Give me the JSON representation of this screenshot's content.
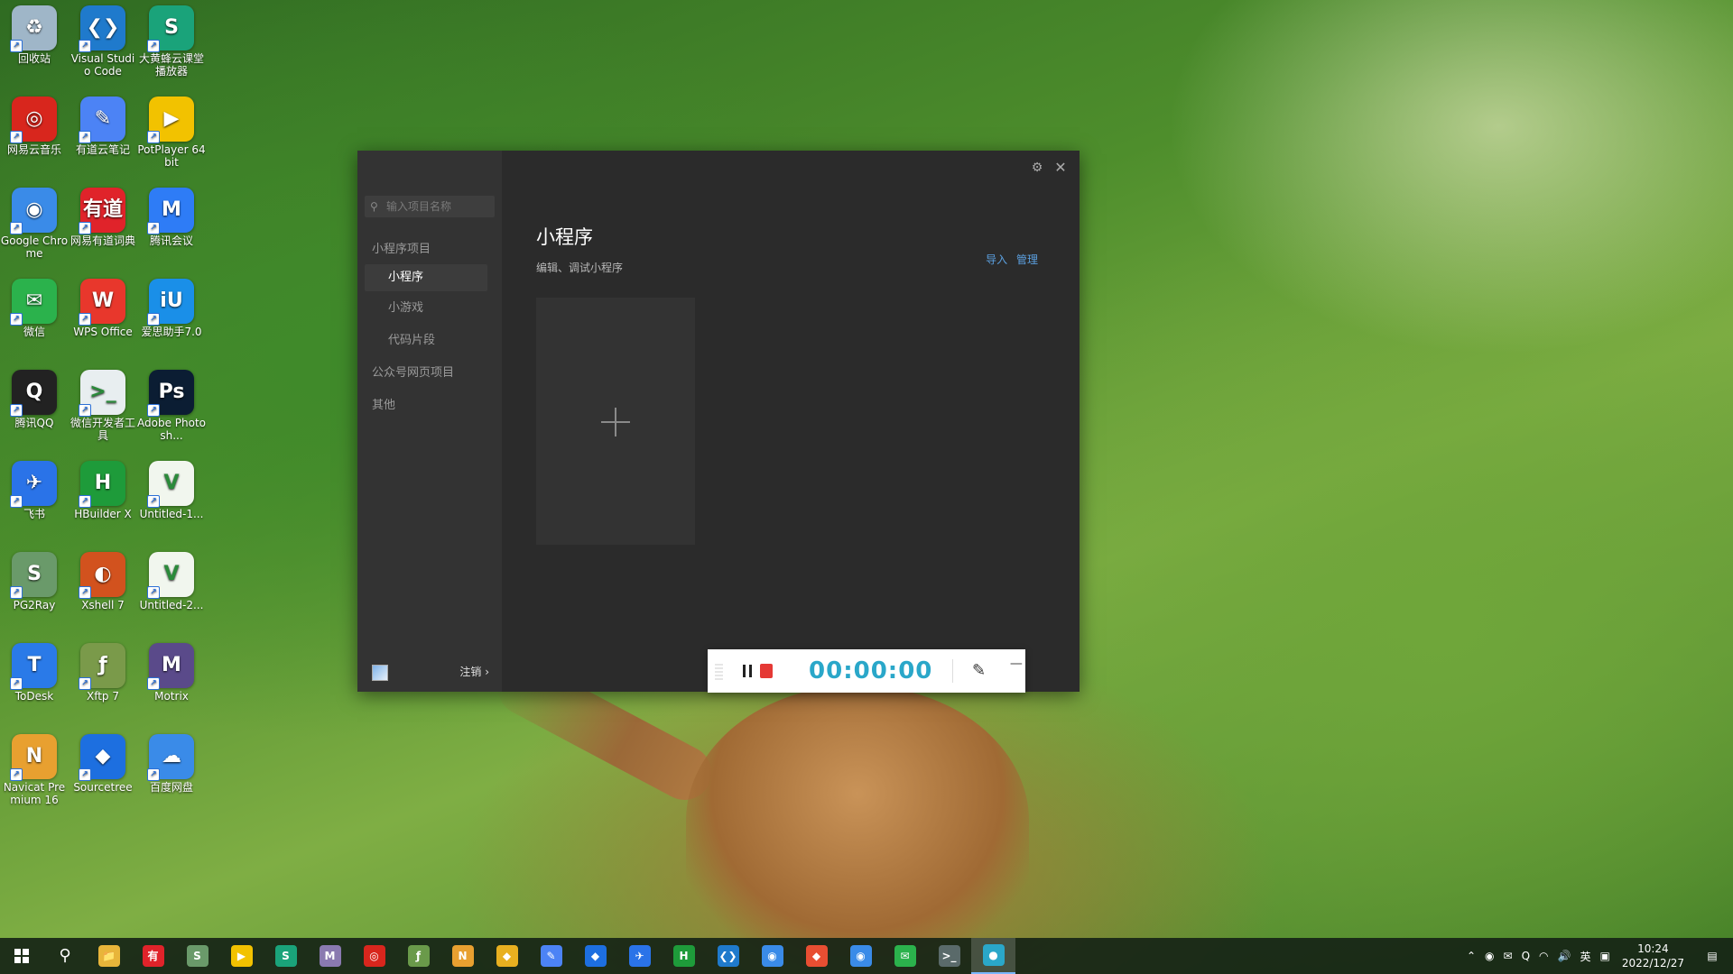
{
  "desktop": {
    "icons": [
      {
        "label": "回收站",
        "glyph": "♻",
        "color": "#9fb6c8",
        "icon": "recycle-bin-icon"
      },
      {
        "label": "Visual Studio Code",
        "glyph": "❮❯",
        "color": "#1f7acc",
        "icon": "vscode-icon"
      },
      {
        "label": "大黄蜂云课堂播放器",
        "glyph": "S",
        "color": "#1aa37a",
        "icon": "player-icon"
      },
      {
        "label": "网易云音乐",
        "glyph": "◎",
        "color": "#d8261d",
        "icon": "netease-music-icon"
      },
      {
        "label": "有道云笔记",
        "glyph": "✎",
        "color": "#4c83f5",
        "icon": "youdao-note-icon"
      },
      {
        "label": "PotPlayer 64 bit",
        "glyph": "▶",
        "color": "#f2c200",
        "icon": "potplayer-icon"
      },
      {
        "label": "Google Chrome",
        "glyph": "◉",
        "color": "#3a8be8",
        "icon": "chrome-icon"
      },
      {
        "label": "网易有道词典",
        "glyph": "有道",
        "color": "#e0232a",
        "icon": "youdao-dict-icon"
      },
      {
        "label": "腾讯会议",
        "glyph": "M",
        "color": "#2e7cf6",
        "icon": "tencent-meeting-icon"
      },
      {
        "label": "微信",
        "glyph": "✉",
        "color": "#2bb24c",
        "icon": "wechat-icon"
      },
      {
        "label": "WPS Office",
        "glyph": "W",
        "color": "#e8372c",
        "icon": "wps-icon"
      },
      {
        "label": "爱思助手7.0",
        "glyph": "iU",
        "color": "#1a8fe8",
        "icon": "i4-icon"
      },
      {
        "label": "腾讯QQ",
        "glyph": "Q",
        "color": "#222222",
        "icon": "qq-icon"
      },
      {
        "label": "微信开发者工具",
        "glyph": ">_",
        "color": "#e8eef0",
        "icon": "wechat-devtools-icon"
      },
      {
        "label": "Adobe Photosh...",
        "glyph": "Ps",
        "color": "#0b1d33",
        "icon": "photoshop-icon"
      },
      {
        "label": "飞书",
        "glyph": "✈",
        "color": "#2a73e8",
        "icon": "feishu-icon"
      },
      {
        "label": "HBuilder X",
        "glyph": "H",
        "color": "#1e9b3a",
        "icon": "hbuilder-icon"
      },
      {
        "label": "Untitled-1...",
        "glyph": "V",
        "color": "#f1f6ee",
        "icon": "file-v-icon"
      },
      {
        "label": "PG2Ray",
        "glyph": "S",
        "color": "#6a9a6a",
        "icon": "pg2ray-icon"
      },
      {
        "label": "Xshell 7",
        "glyph": "◐",
        "color": "#d2521e",
        "icon": "xshell-icon"
      },
      {
        "label": "Untitled-2...",
        "glyph": "V",
        "color": "#f1f6ee",
        "icon": "file-v-icon"
      },
      {
        "label": "ToDesk",
        "glyph": "T",
        "color": "#2a7ae8",
        "icon": "todesk-icon"
      },
      {
        "label": "Xftp 7",
        "glyph": "ƒ",
        "color": "#7a9a4a",
        "icon": "xftp-icon"
      },
      {
        "label": "Motrix",
        "glyph": "M",
        "color": "#5a4a8a",
        "icon": "motrix-icon"
      },
      {
        "label": "Navicat Premium 16",
        "glyph": "N",
        "color": "#e8a030",
        "icon": "navicat-icon"
      },
      {
        "label": "Sourcetree",
        "glyph": "◆",
        "color": "#1d6fe0",
        "icon": "sourcetree-icon"
      },
      {
        "label": "百度网盘",
        "glyph": "☁",
        "color": "#3a8be8",
        "icon": "baidu-pan-icon"
      }
    ]
  },
  "app": {
    "sidebar": {
      "search_placeholder": "输入项目名称",
      "groups": {
        "mini_program_project": "小程序项目",
        "mini_program": "小程序",
        "mini_game": "小游戏",
        "code_snippet": "代码片段",
        "official_web": "公众号网页项目",
        "other": "其他"
      },
      "logout": "注销 ›"
    },
    "main": {
      "title": "小程序",
      "subtitle": "编辑、调试小程序",
      "import": "导入",
      "manage": "管理"
    }
  },
  "recorder": {
    "time": "00:00:00"
  },
  "taskbar": {
    "apps": [
      {
        "icon": "file-explorer-icon",
        "glyph": "📁",
        "color": "#e8b53a"
      },
      {
        "icon": "youdao-dict-icon",
        "glyph": "有",
        "color": "#e0232a"
      },
      {
        "icon": "pg2ray-icon",
        "glyph": "S",
        "color": "#6a9a6a"
      },
      {
        "icon": "potplayer-icon",
        "glyph": "▶",
        "color": "#f2c200"
      },
      {
        "icon": "player-icon",
        "glyph": "S",
        "color": "#1aa37a"
      },
      {
        "icon": "motrix-icon",
        "glyph": "M",
        "color": "#8a7ab0"
      },
      {
        "icon": "netease-music-icon",
        "glyph": "◎",
        "color": "#d8261d"
      },
      {
        "icon": "xftp-icon",
        "glyph": "ƒ",
        "color": "#6a9a4a"
      },
      {
        "icon": "navicat-icon",
        "glyph": "N",
        "color": "#e8a030"
      },
      {
        "icon": "tool-icon",
        "glyph": "◆",
        "color": "#e8b020"
      },
      {
        "icon": "youdao-note-icon",
        "glyph": "✎",
        "color": "#4c83f5"
      },
      {
        "icon": "sourcetree-icon",
        "glyph": "◆",
        "color": "#1d6fe0"
      },
      {
        "icon": "feishu-icon",
        "glyph": "✈",
        "color": "#2a73e8"
      },
      {
        "icon": "hbuilder-icon",
        "glyph": "H",
        "color": "#1e9b3a"
      },
      {
        "icon": "vscode-icon",
        "glyph": "❮❯",
        "color": "#1f7acc"
      },
      {
        "icon": "chrome-icon",
        "glyph": "◉",
        "color": "#3a8be8"
      },
      {
        "icon": "git-icon",
        "glyph": "◆",
        "color": "#e84e32"
      },
      {
        "icon": "chrome-icon",
        "glyph": "◉",
        "color": "#3a8be8"
      },
      {
        "icon": "wechat-icon",
        "glyph": "✉",
        "color": "#2bb24c"
      },
      {
        "icon": "wechat-devtools-icon",
        "glyph": ">_",
        "color": "#5a6a6a"
      },
      {
        "icon": "screen-recorder-icon",
        "glyph": "●",
        "color": "#2aa7c9"
      }
    ],
    "tray": {
      "ime": "英",
      "time": "10:24",
      "date": "2022/12/27"
    }
  }
}
